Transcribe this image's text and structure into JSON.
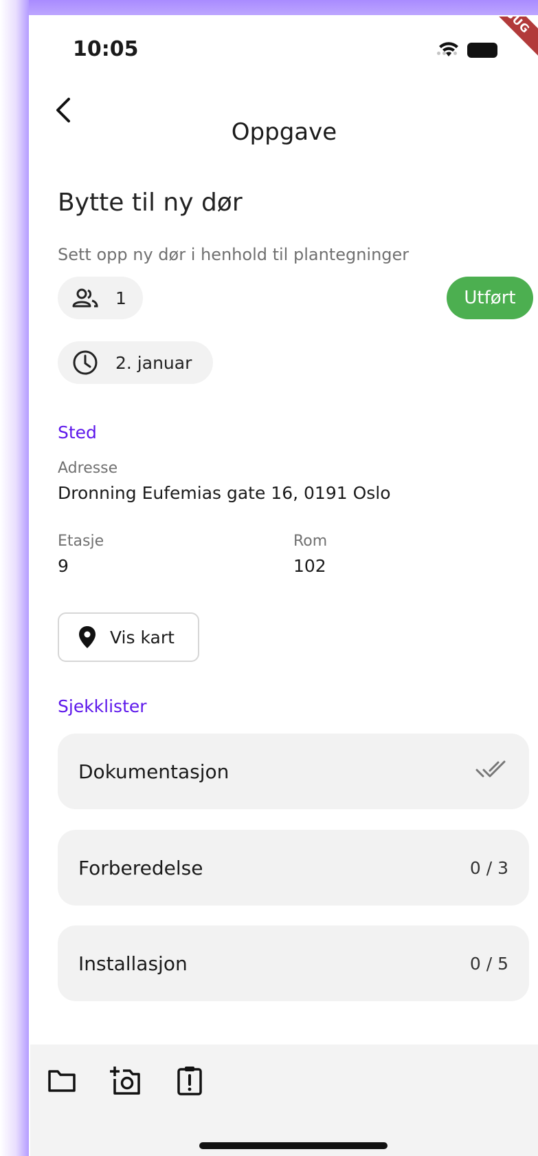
{
  "status_bar": {
    "time": "10:05",
    "debug_label": "DEBUG"
  },
  "header": {
    "title": "Oppgave"
  },
  "task": {
    "title": "Bytte til ny dør",
    "description": "Sett opp ny dør i henhold til plantegninger",
    "people_count": "1",
    "status": "Utført",
    "status_color": "#4caf50",
    "date": "2. januar"
  },
  "location": {
    "section_label": "Sted",
    "address_label": "Adresse",
    "address": "Dronning Eufemias gate 16, 0191 Oslo",
    "floor_label": "Etasje",
    "floor": "9",
    "room_label": "Rom",
    "room": "102",
    "map_button": "Vis kart"
  },
  "checklists": {
    "section_label": "Sjekklister",
    "items": [
      {
        "name": "Dokumentasjon",
        "progress": "",
        "icon": "done-all-icon"
      },
      {
        "name": "Forberedelse",
        "progress": "0 / 3"
      },
      {
        "name": "Installasjon",
        "progress": "0 / 5"
      }
    ]
  },
  "bottom_bar": {
    "icons": [
      "folder-icon",
      "add-photo-icon",
      "report-clipboard-icon"
    ]
  },
  "colors": {
    "accent": "#5d17eb",
    "success": "#4caf50",
    "chip_bg": "#f2f2f2",
    "frame": "#b49cff"
  }
}
